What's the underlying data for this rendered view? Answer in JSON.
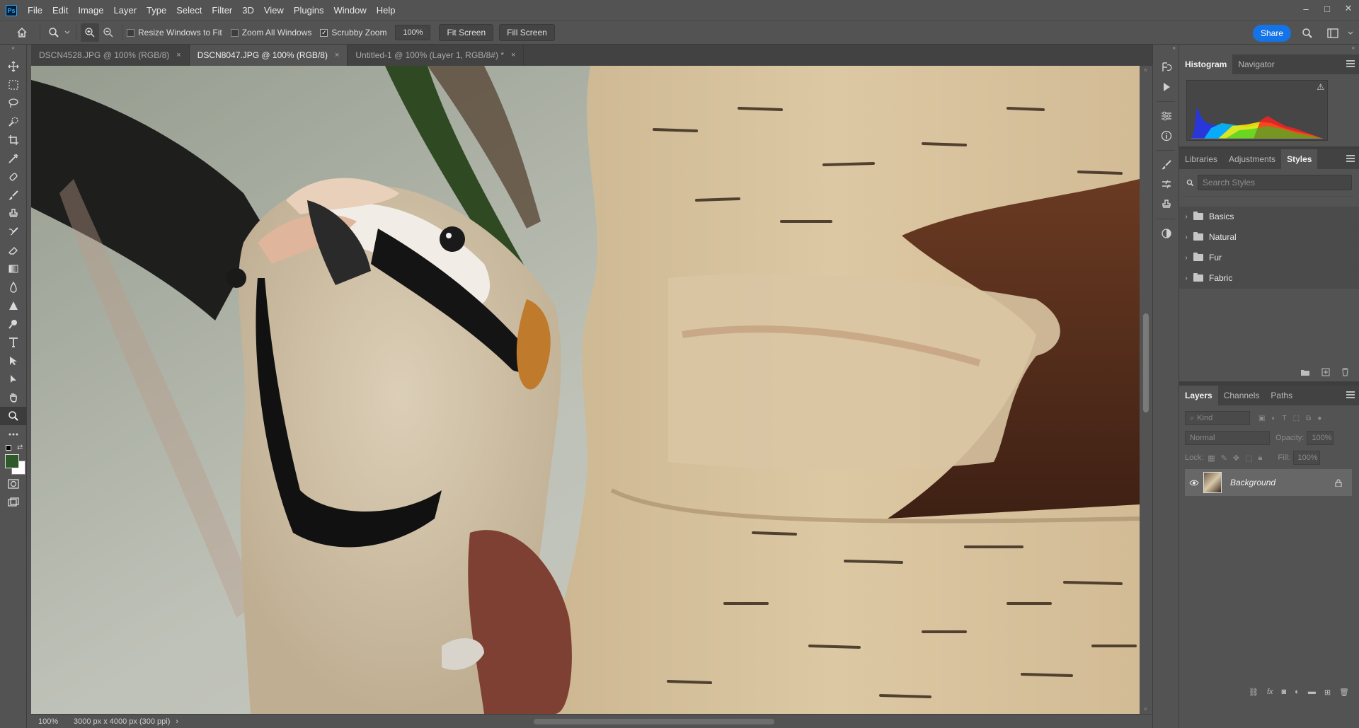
{
  "app": {
    "logo": "Ps"
  },
  "menubar": {
    "items": [
      "File",
      "Edit",
      "Image",
      "Layer",
      "Type",
      "Select",
      "Filter",
      "3D",
      "View",
      "Plugins",
      "Window",
      "Help"
    ]
  },
  "window_controls": {
    "minimize": "–",
    "maximize": "□",
    "close": "✕"
  },
  "options": {
    "resize_windows": "Resize Windows to Fit",
    "zoom_all": "Zoom All Windows",
    "scrubby_zoom": "Scrubby Zoom",
    "zoom_percent": "100%",
    "fit_screen": "Fit Screen",
    "fill_screen": "Fill Screen",
    "share": "Share",
    "resize_windows_checked": false,
    "zoom_all_checked": false,
    "scrubby_zoom_checked": true
  },
  "tabs": [
    {
      "label": "DSCN4528.JPG @ 100% (RGB/8)",
      "close": "×",
      "active": false
    },
    {
      "label": "DSCN8047.JPG @ 100% (RGB/8)",
      "close": "×",
      "active": true
    },
    {
      "label": "Untitled-1 @ 100% (Layer 1, RGB/8#) *",
      "close": "×",
      "active": false
    }
  ],
  "status": {
    "zoom": "100%",
    "doc_size": "3000 px x 4000 px (300 ppi)",
    "arrow": "›"
  },
  "histogram_panel": {
    "tabs": [
      "Histogram",
      "Navigator"
    ],
    "warning": "⚠"
  },
  "styles_panel": {
    "tabs": [
      "Libraries",
      "Adjustments",
      "Styles"
    ],
    "search_placeholder": "Search Styles",
    "groups": [
      "Basics",
      "Natural",
      "Fur",
      "Fabric"
    ]
  },
  "layers_panel": {
    "tabs": [
      "Layers",
      "Channels",
      "Paths"
    ],
    "kind": "Kind",
    "blend_mode": "Normal",
    "opacity_label": "Opacity:",
    "opacity_value": "100%",
    "lock_label": "Lock:",
    "fill_label": "Fill:",
    "fill_value": "100%",
    "layers": [
      {
        "name": "Background",
        "visible": true,
        "locked": true
      }
    ]
  },
  "colors": {
    "accent": "#1473e6",
    "foreground": "#2e5a2a",
    "background": "#ffffff"
  }
}
